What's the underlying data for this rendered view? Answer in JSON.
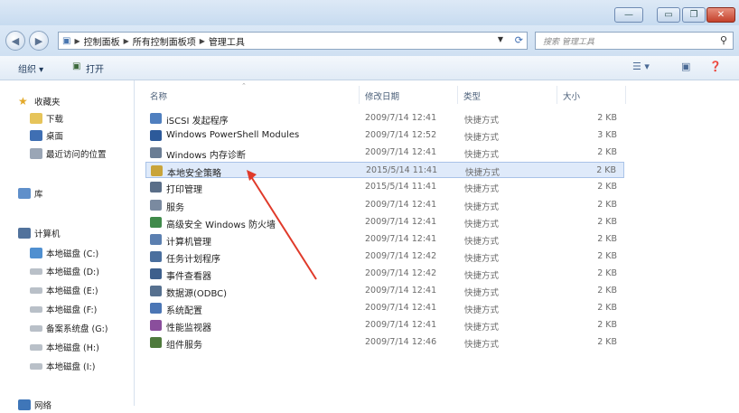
{
  "window": {
    "caption_buttons": {
      "minimize": "—",
      "maximize": "▭",
      "restore": "❐",
      "close": "✕"
    }
  },
  "address": {
    "segments": [
      "控制面板",
      "所有控制面板项",
      "管理工具"
    ],
    "search_placeholder": "搜索 管理工具"
  },
  "toolbar": {
    "organize": "组织 ▾",
    "open": "打开"
  },
  "sidebar": {
    "favorites": "收藏夹",
    "favorites_items": [
      "下载",
      "桌面",
      "最近访问的位置"
    ],
    "libraries": "库",
    "computer": "计算机",
    "drives": [
      "本地磁盘 (C:)",
      "本地磁盘 (D:)",
      "本地磁盘 (E:)",
      "本地磁盘 (F:)",
      "备案系统盘 (G:)",
      "本地磁盘 (H:)",
      "本地磁盘 (I:)"
    ],
    "network": "网络"
  },
  "columns": {
    "name": "名称",
    "date": "修改日期",
    "type": "类型",
    "size": "大小"
  },
  "files": [
    {
      "name": "iSCSI 发起程序",
      "date": "2009/7/14 12:41",
      "type": "快捷方式",
      "size": "2 KB",
      "icon": "iscsi-icon",
      "color": "#4f7fbf"
    },
    {
      "name": "Windows PowerShell Modules",
      "date": "2009/7/14 12:52",
      "type": "快捷方式",
      "size": "3 KB",
      "icon": "powershell-icon",
      "color": "#2d5a9a"
    },
    {
      "name": "Windows 内存诊断",
      "date": "2009/7/14 12:41",
      "type": "快捷方式",
      "size": "2 KB",
      "icon": "memory-icon",
      "color": "#6a7d94"
    },
    {
      "name": "本地安全策略",
      "date": "2015/5/14 11:41",
      "type": "快捷方式",
      "size": "2 KB",
      "icon": "security-policy-icon",
      "color": "#c9a43a",
      "selected": true
    },
    {
      "name": "打印管理",
      "date": "2015/5/14 11:41",
      "type": "快捷方式",
      "size": "2 KB",
      "icon": "printer-icon",
      "color": "#5a6e88"
    },
    {
      "name": "服务",
      "date": "2009/7/14 12:41",
      "type": "快捷方式",
      "size": "2 KB",
      "icon": "services-icon",
      "color": "#7a8aa0"
    },
    {
      "name": "高级安全 Windows 防火墙",
      "date": "2009/7/14 12:41",
      "type": "快捷方式",
      "size": "2 KB",
      "icon": "firewall-icon",
      "color": "#3f8a4a"
    },
    {
      "name": "计算机管理",
      "date": "2009/7/14 12:41",
      "type": "快捷方式",
      "size": "2 KB",
      "icon": "computer-management-icon",
      "color": "#5b7fb0"
    },
    {
      "name": "任务计划程序",
      "date": "2009/7/14 12:42",
      "type": "快捷方式",
      "size": "2 KB",
      "icon": "task-scheduler-icon",
      "color": "#4a6f9e"
    },
    {
      "name": "事件查看器",
      "date": "2009/7/14 12:42",
      "type": "快捷方式",
      "size": "2 KB",
      "icon": "event-viewer-icon",
      "color": "#3d5f8c"
    },
    {
      "name": "数据源(ODBC)",
      "date": "2009/7/14 12:41",
      "type": "快捷方式",
      "size": "2 KB",
      "icon": "odbc-icon",
      "color": "#56708f"
    },
    {
      "name": "系统配置",
      "date": "2009/7/14 12:41",
      "type": "快捷方式",
      "size": "2 KB",
      "icon": "system-config-icon",
      "color": "#4b76b5"
    },
    {
      "name": "性能监视器",
      "date": "2009/7/14 12:41",
      "type": "快捷方式",
      "size": "2 KB",
      "icon": "performance-icon",
      "color": "#8a4e9c"
    },
    {
      "name": "组件服务",
      "date": "2009/7/14 12:46",
      "type": "快捷方式",
      "size": "2 KB",
      "icon": "component-services-icon",
      "color": "#4e7a3c"
    }
  ],
  "colors": {
    "annotation_arrow": "#e03a2a",
    "selection": "#dfeafa"
  }
}
